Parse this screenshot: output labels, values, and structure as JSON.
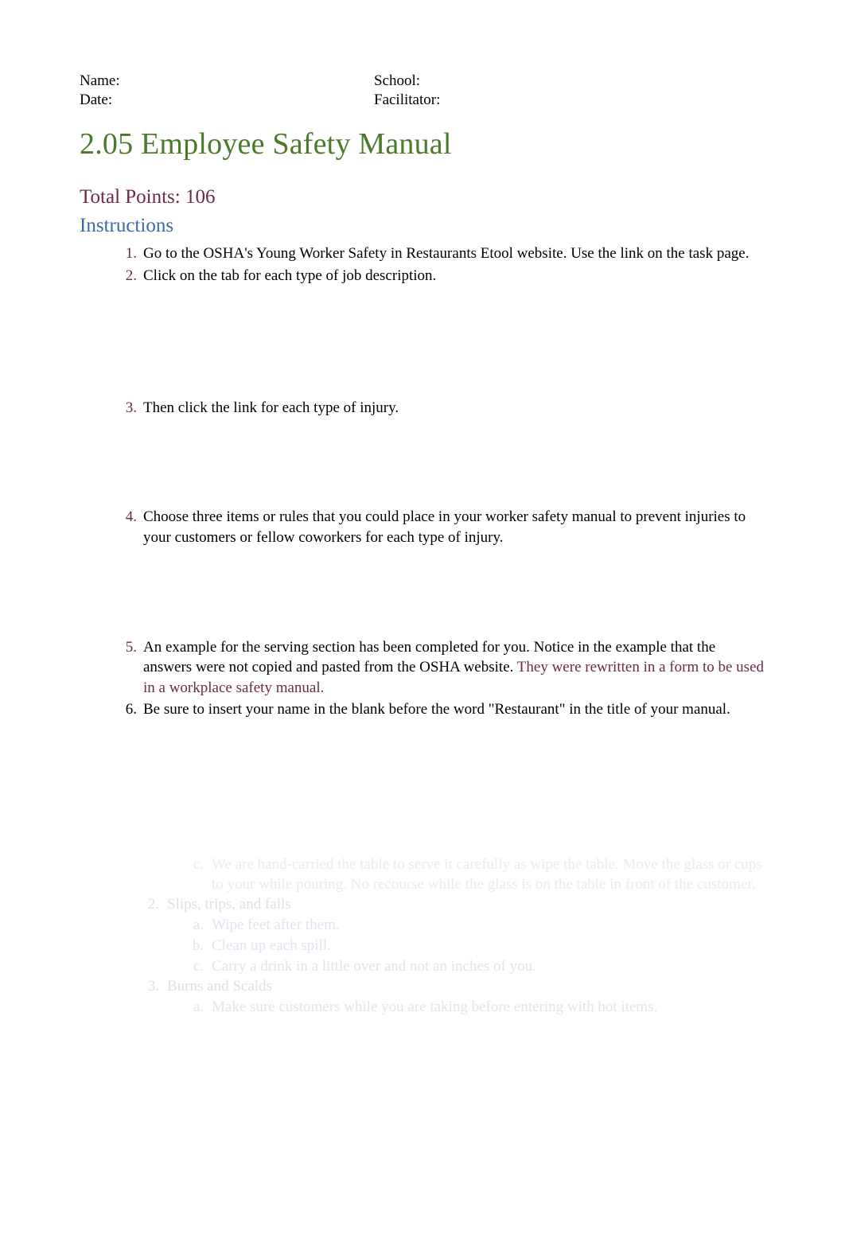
{
  "header": {
    "name_label": "Name:",
    "date_label": "Date:",
    "school_label": "School:",
    "facilitator_label": "Facilitator:"
  },
  "title": "2.05 Employee Safety Manual",
  "points": "Total Points: 106",
  "instructions_heading": "Instructions",
  "list": {
    "n1": "1.",
    "t1": "Go to the OSHA's Young Worker Safety in Restaurants Etool website. Use the link on the task page.",
    "n2": "2.",
    "t2": "Click on the tab for each type of job description.",
    "n3": "3.",
    "t3": "Then click the link for each type of injury.",
    "n4": "4.",
    "t4": "Choose three items or rules that you could place in your worker safety manual to prevent injuries to your customers or fellow coworkers for each type of injury.",
    "n5": "5.",
    "t5a": "An example for the serving section has been completed for you. Notice in the example that the answers were not copied and pasted from the OSHA website.         ",
    "t5b": "They were rewritten in a form to be used in a workplace safety manual.",
    "n6": "6.",
    "t6": "Be sure to insert your name in the blank before the word \"Restaurant\" in the title of your manual."
  },
  "faded": {
    "m_c": "c.",
    "t_c": "We are hand-carried the table to serve it carefully as wipe the table. Move the glass or cups to your while pouring. No recourse while the glass is on the table in front of the customer.",
    "m_2": "2.",
    "t_2": "Slips, trips, and falls",
    "m_2a": "a.",
    "t_2a": "Wipe feet after them.",
    "m_2b": "b.",
    "t_2b": "Clean up each spill.",
    "m_2c": "c.",
    "t_2c": "Carry a drink in a little over and not an inches of you.",
    "m_3": "3.",
    "t_3": "Burns and Scalds",
    "m_3a": "a.",
    "t_3a": "Make sure customers while you are taking before entering with hot items."
  }
}
